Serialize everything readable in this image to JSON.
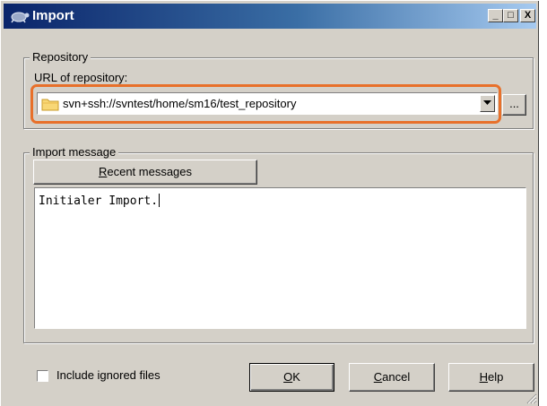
{
  "window": {
    "title": "Import",
    "min_label": "_",
    "max_label": "□",
    "close_label": "X"
  },
  "repository": {
    "group_label": "Repository",
    "url_label": "URL of repository:",
    "url_value": "svn+ssh://svntest/home/sm16/test_repository",
    "browse_label": "..."
  },
  "message": {
    "group_label": "Import message",
    "recent_label_prefix": "",
    "recent_label_u": "R",
    "recent_label_rest": "ecent messages",
    "text": "Initialer Import."
  },
  "footer": {
    "include_ignored_label": "Include ignored files",
    "include_ignored_checked": false,
    "ok_u": "O",
    "ok_rest": "K",
    "cancel_u": "C",
    "cancel_rest": "ancel",
    "help_u": "H",
    "help_rest": "elp"
  },
  "colors": {
    "highlight": "#e8702a",
    "titlebar_start": "#0a246a",
    "titlebar_end": "#a6caf0",
    "dialog_face": "#d4d0c8"
  }
}
